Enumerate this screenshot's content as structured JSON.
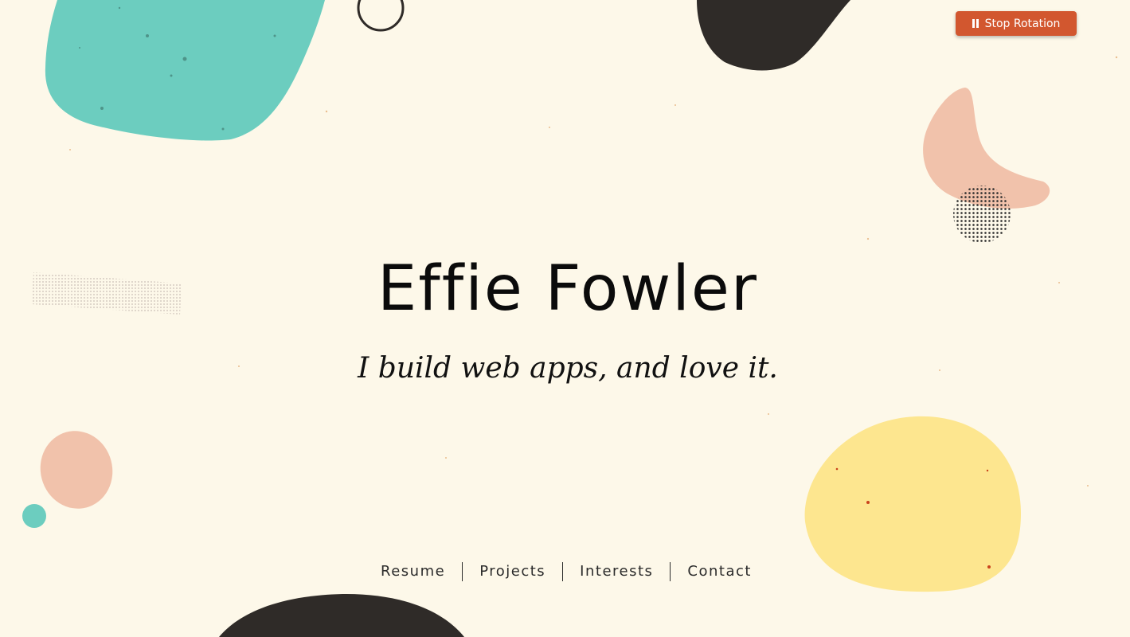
{
  "header": {
    "name": "Effie Fowler",
    "tagline": "I build web apps, and love it."
  },
  "controls": {
    "stop_rotation_label": "Stop Rotation",
    "stop_rotation_icon": "pause-icon"
  },
  "nav": {
    "items": [
      {
        "label": "Resume"
      },
      {
        "label": "Projects"
      },
      {
        "label": "Interests"
      },
      {
        "label": "Contact"
      }
    ]
  },
  "colors": {
    "background": "#fdf8e9",
    "teal": "#6ccdbf",
    "charcoal": "#2f2b28",
    "peach": "#f1c2ab",
    "yellow": "#fde68f",
    "button": "#d2572f"
  }
}
